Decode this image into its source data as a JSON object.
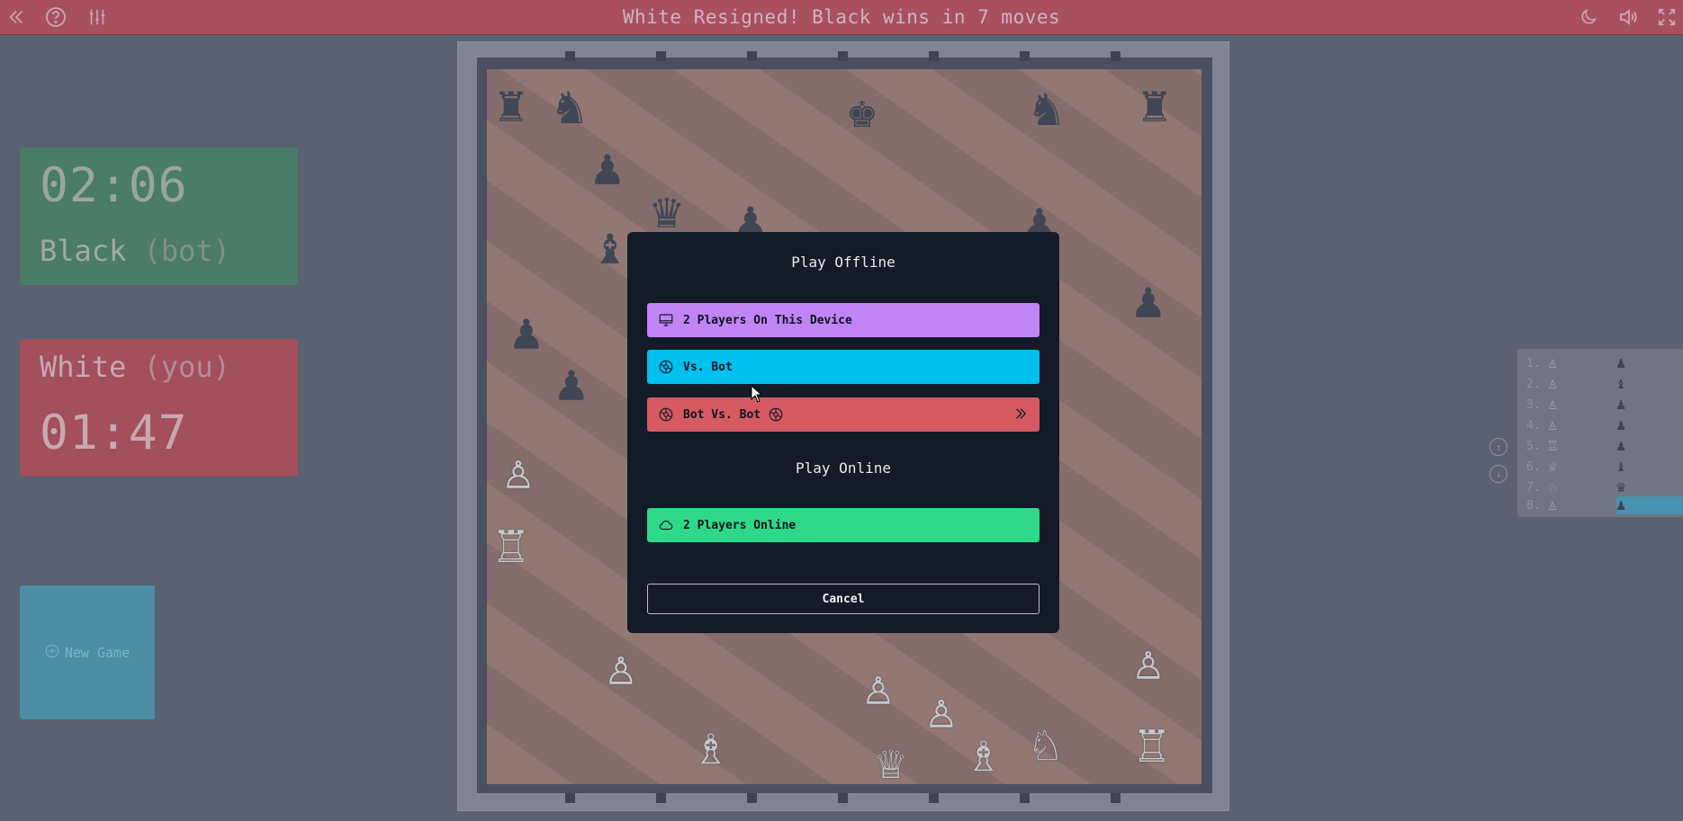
{
  "topbar": {
    "status_text": "White Resigned! Black wins in 7 moves",
    "icons_left": [
      "double-chevron-left-icon",
      "help-icon",
      "sliders-icon"
    ],
    "icons_right": [
      "moon-icon",
      "volume-icon",
      "fullscreen-icon"
    ]
  },
  "clocks": {
    "black": {
      "time": "02:06",
      "name": "Black",
      "tag": "(bot)"
    },
    "white": {
      "name": "White",
      "tag": "(you)",
      "time": "01:47"
    }
  },
  "new_game": {
    "label": "New Game"
  },
  "modal": {
    "offline_heading": "Play Offline",
    "btn_two_players_device": "2 Players On This Device",
    "btn_vs_bot": "Vs. Bot",
    "btn_bot_vs_bot": "Bot Vs. Bot",
    "online_heading": "Play Online",
    "btn_two_players_online": "2 Players Online",
    "btn_cancel": "Cancel",
    "colors": {
      "two_players_device": "#c084f5",
      "vs_bot": "#00c0f0",
      "bot_vs_bot": "#d55a62",
      "online": "#2fd889"
    }
  },
  "moves": [
    {
      "n": "1.",
      "w": "♙",
      "b": "♟"
    },
    {
      "n": "2.",
      "w": "♙",
      "b": "♝"
    },
    {
      "n": "3.",
      "w": "♙",
      "b": "♟"
    },
    {
      "n": "4.",
      "w": "♙",
      "b": "♟"
    },
    {
      "n": "5.",
      "w": "♖",
      "b": "♟"
    },
    {
      "n": "6.",
      "w": "♕",
      "b": "♝"
    },
    {
      "n": "7.",
      "w": "♘",
      "b": "♛"
    },
    {
      "n": "8.",
      "w": "♙",
      "b": "♟"
    }
  ],
  "board_pieces": {
    "black": [
      "♜",
      "♞",
      "♚",
      "♞",
      "♜",
      "♟",
      "♛",
      "♟",
      "♝",
      "♟",
      "♟",
      "♟",
      "♟"
    ],
    "white": [
      "♙",
      "♖",
      "♙",
      "♙",
      "♙",
      "♗",
      "♕",
      "♗",
      "♘",
      "♖",
      "♙"
    ]
  }
}
